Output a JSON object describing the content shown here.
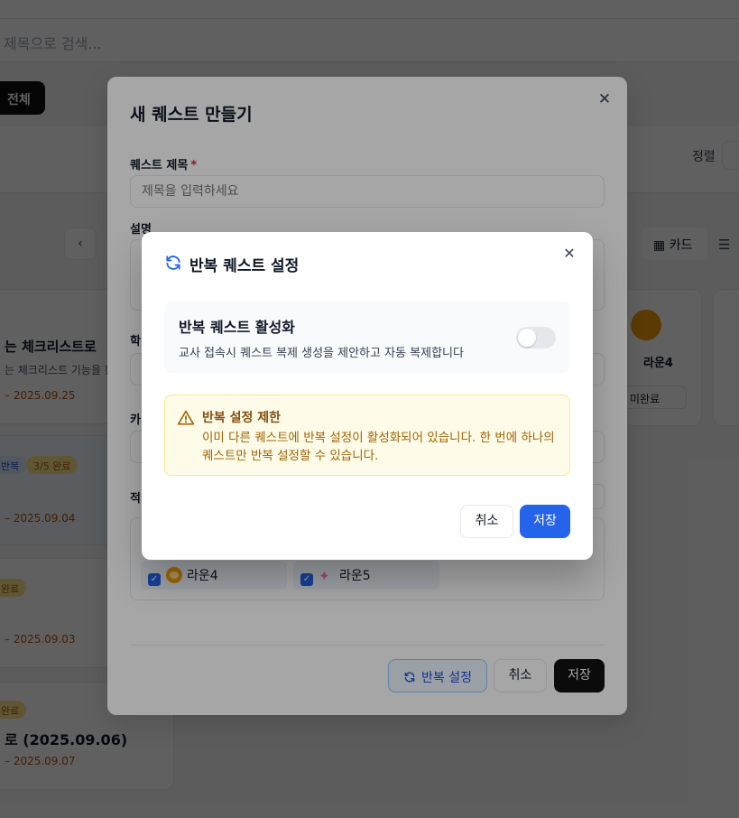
{
  "background": {
    "search_placeholder": "제목으로 검색...",
    "filter_all_label": "전체",
    "sort_label": "정렬",
    "view_card_label": "카드",
    "prev_label": "‹",
    "cards": [
      {
        "title": "는 체크리스트로",
        "desc": "는 체크리스트 기능을 활...",
        "date": "– 2025.09.25"
      },
      {
        "badges": [
          "반복",
          "3/5 완료"
        ],
        "title": "",
        "date": "– 2025.09.04"
      },
      {
        "badges": [
          "완료"
        ],
        "title": "",
        "date": "– 2025.09.03"
      },
      {
        "badges": [
          "완료"
        ],
        "title": "로 (2025.09.06)",
        "date": "– 2025.09.07"
      }
    ],
    "student_card": {
      "name": "라운4",
      "status": "미완료"
    }
  },
  "quest_modal": {
    "title": "새 퀘스트 만들기",
    "close_label": "✕",
    "title_field": {
      "label": "퀘스트 제목",
      "required_mark": "*",
      "placeholder": "제목을 입력하세요"
    },
    "description_label": "설명",
    "partial_labels": [
      "학",
      "카",
      "적"
    ],
    "students": [
      {
        "name": "라운4"
      },
      {
        "name": "라운5"
      }
    ],
    "buttons": {
      "repeat": "반복 설정",
      "cancel": "취소",
      "save": "저장"
    }
  },
  "repeat_modal": {
    "title": "반복 퀘스트 설정",
    "close_label": "✕",
    "toggle": {
      "title": "반복 퀘스트 활성화",
      "description": "교사 접속시 퀘스트 복제 생성을 제안하고 자동 복제합니다",
      "enabled": false
    },
    "warning": {
      "title": "반복 설정 제한",
      "message": "이미 다른 퀘스트에 반복 설정이 활성화되어 있습니다. 한 번에 하나의 퀘스트만 반복 설정할 수 있습니다."
    },
    "buttons": {
      "cancel": "취소",
      "save": "저장"
    }
  },
  "colors": {
    "primary": "#2563eb",
    "dark": "#111111",
    "warning_bg": "#fefce8",
    "warning_text": "#a16207"
  }
}
